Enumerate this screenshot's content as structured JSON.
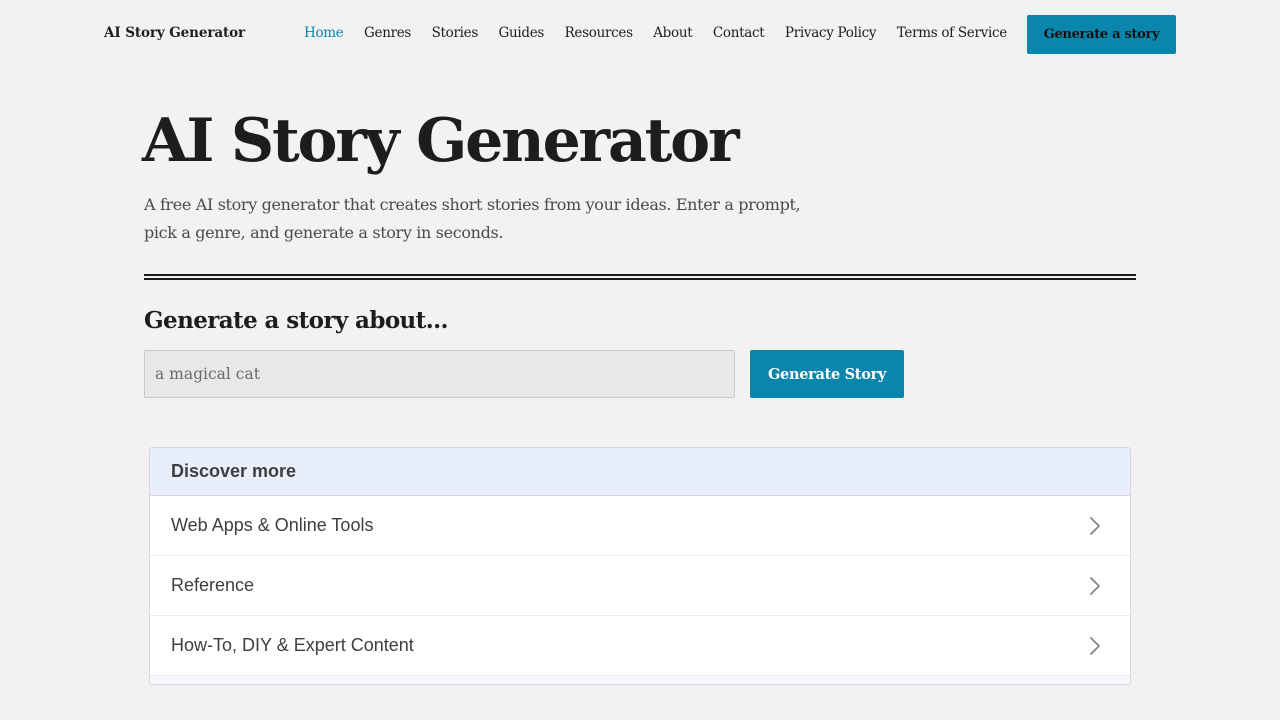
{
  "header": {
    "brand": "AI Story Generator",
    "nav": [
      {
        "label": "Home",
        "active": true
      },
      {
        "label": "Genres"
      },
      {
        "label": "Stories"
      },
      {
        "label": "Guides"
      },
      {
        "label": "Resources"
      },
      {
        "label": "About"
      },
      {
        "label": "Contact"
      },
      {
        "label": "Privacy Policy"
      },
      {
        "label": "Terms of Service"
      }
    ],
    "cta_label": "Generate a story"
  },
  "hero": {
    "title": "AI Story Generator",
    "description": "A free AI story generator that creates short stories from your ideas. Enter a prompt, pick a genre, and generate a story in seconds."
  },
  "form": {
    "heading": "Generate a story about...",
    "input_placeholder": "a magical cat",
    "input_value": "",
    "submit_label": "Generate Story"
  },
  "discover": {
    "title": "Discover more",
    "items": [
      {
        "label": "Web Apps & Online Tools",
        "icon": "chevron-right-icon"
      },
      {
        "label": "Reference",
        "icon": "chevron-right-icon"
      },
      {
        "label": "How-To, DIY & Expert Content",
        "icon": "chevron-right-icon"
      }
    ]
  },
  "colors": {
    "accent": "#0a85ab",
    "background": "#f2f2f2",
    "text": "#1d1d1b",
    "discover_header_bg": "#e8effb"
  }
}
